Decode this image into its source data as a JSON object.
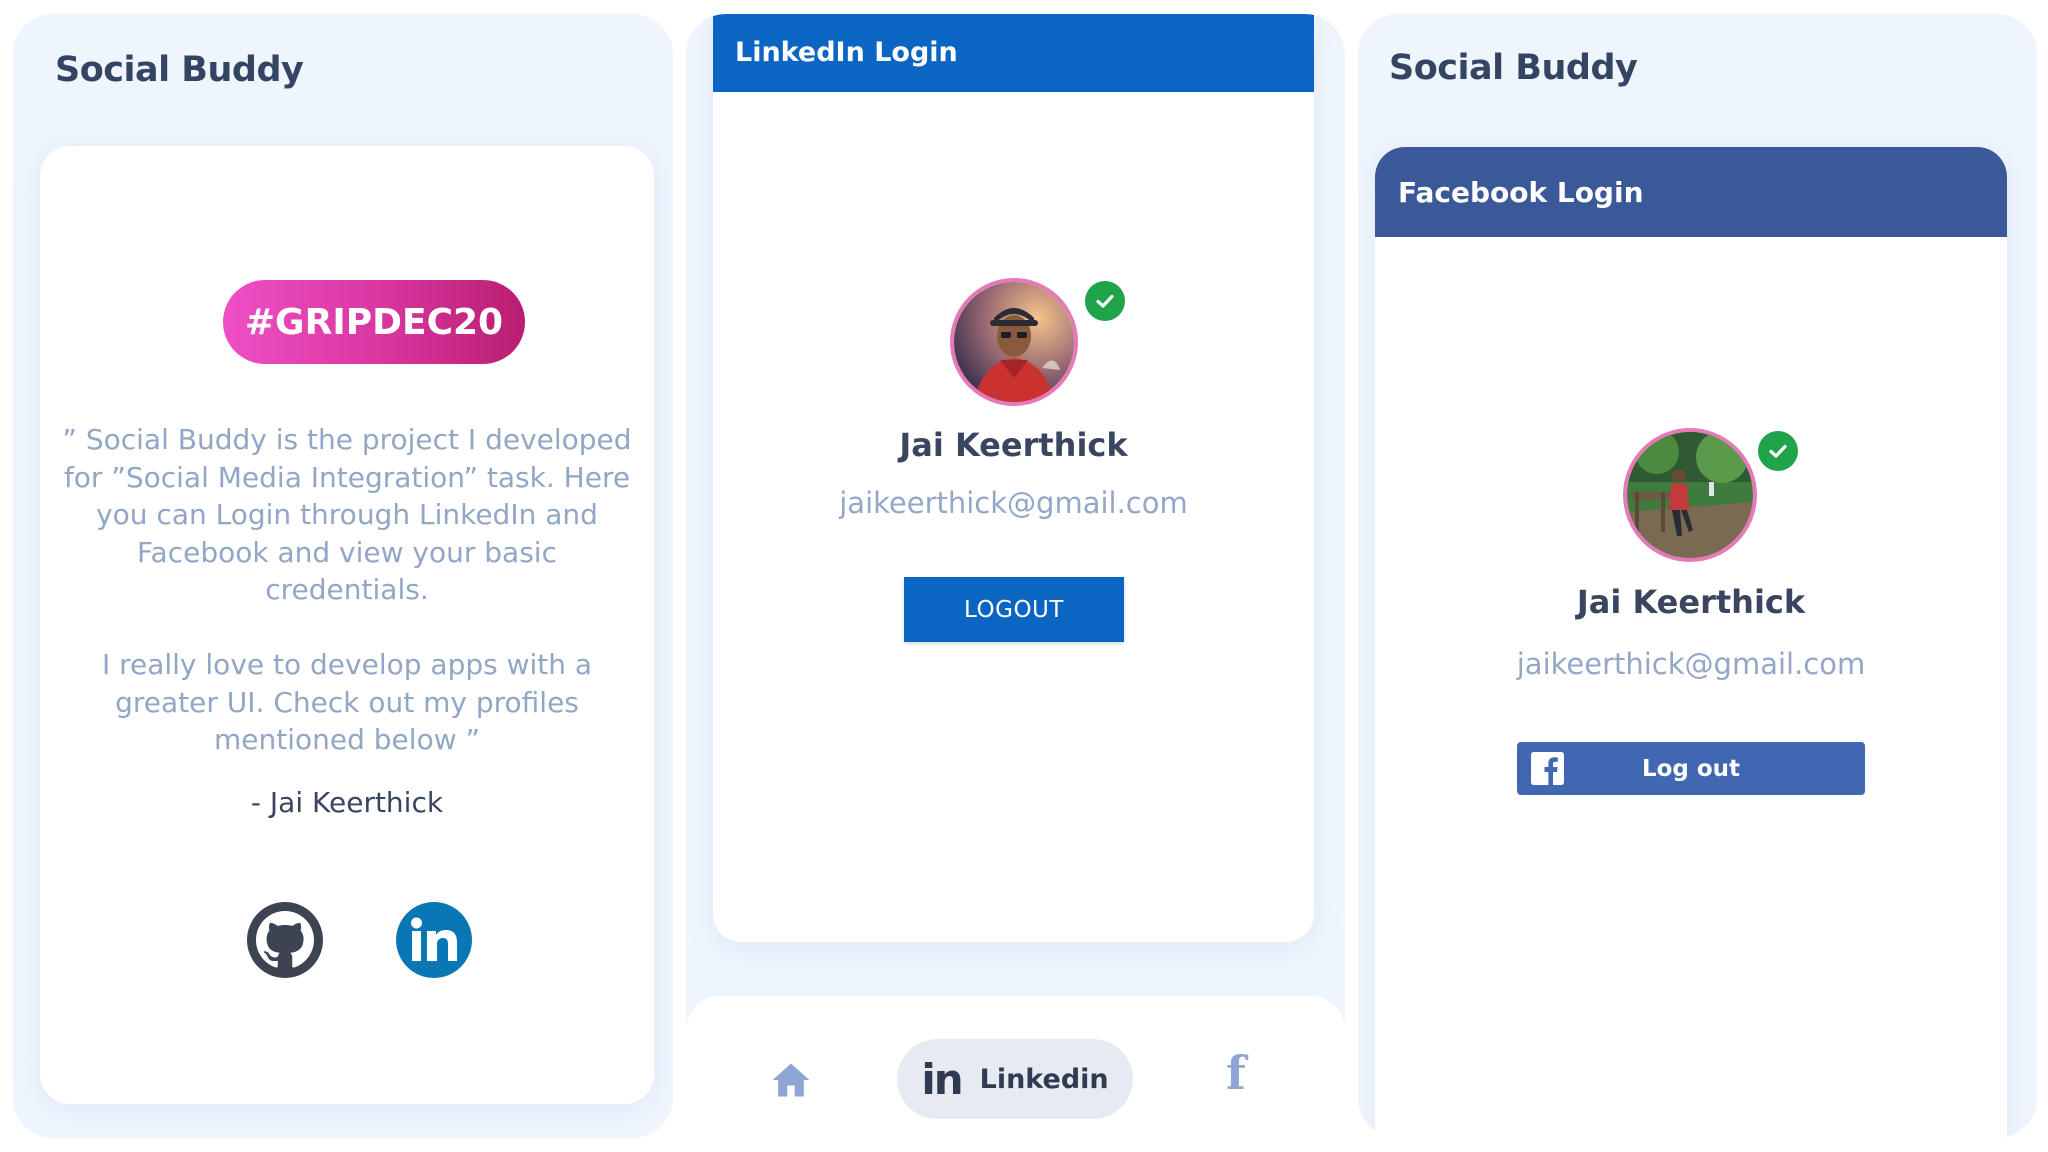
{
  "screen1": {
    "app_title": "Social Buddy",
    "tag": "#GRIPDEC20",
    "description_1": "” Social Buddy is the project I developed for ”Social Media Integration” task. Here you can Login through LinkedIn and Facebook and view your basic credentials.",
    "description_2": "I really love to develop apps with a greater UI. Check out my profiles mentioned below ”",
    "author": "- Jai Keerthick",
    "links": [
      {
        "icon": "github-icon"
      },
      {
        "icon": "linkedin-icon"
      }
    ]
  },
  "screen2": {
    "header": "LinkedIn Login",
    "user_name": "Jai Keerthick",
    "user_email": "jaikeerthick@gmail.com",
    "logout_label": "LOGOUT",
    "nav": {
      "items": [
        {
          "icon": "home-icon"
        },
        {
          "icon": "linkedin-icon",
          "label": "Linkedin",
          "active": true
        },
        {
          "icon": "facebook-icon"
        }
      ]
    }
  },
  "screen3": {
    "app_title": "Social Buddy",
    "header": "Facebook Login",
    "user_name": "Jai Keerthick",
    "user_email": "jaikeerthick@gmail.com",
    "logout_label": "Log out"
  },
  "colors": {
    "background": "#eff5fd",
    "title_text": "#344563",
    "tag_gradient_start": "#ee4fc5",
    "tag_gradient_end": "#b81e70",
    "muted_text": "#92a6c6",
    "linkedin_blue": "#0a66c2",
    "facebook_blue": "#3b5998",
    "facebook_button": "#4267b2",
    "verified_green": "#1fa44a",
    "avatar_ring": "#e57ab9"
  }
}
